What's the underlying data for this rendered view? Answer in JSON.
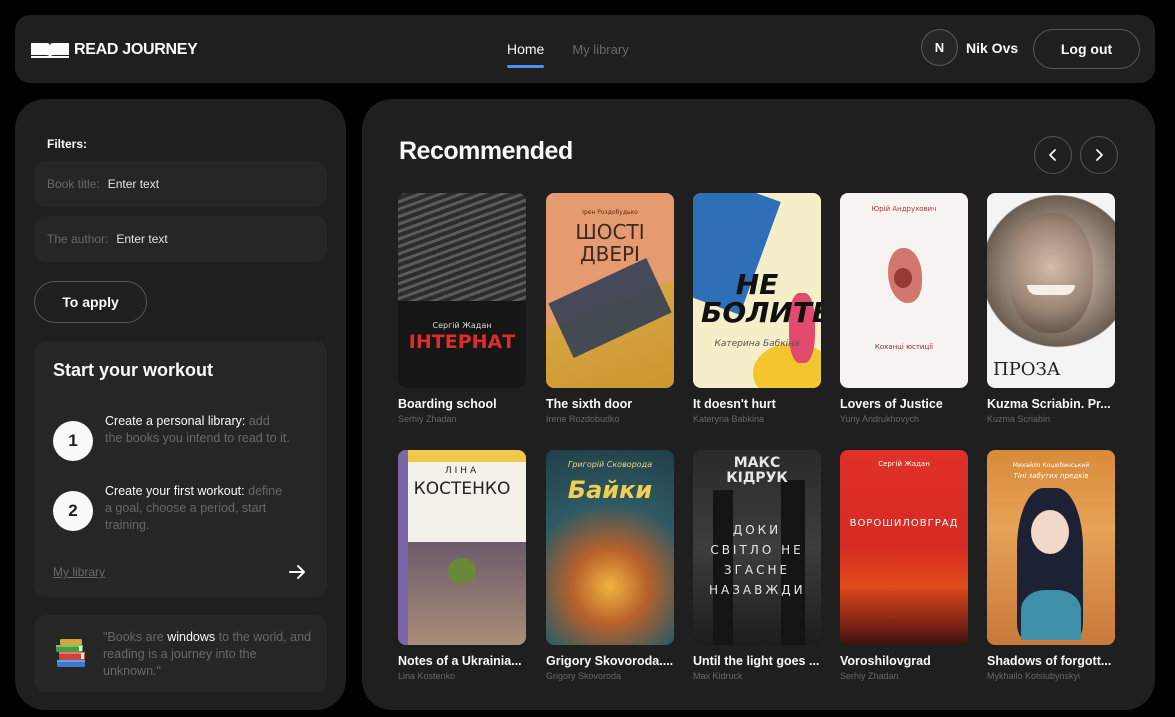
{
  "header": {
    "logo_text": "READ JOURNEY",
    "nav": {
      "home": "Home",
      "library": "My library"
    },
    "user": {
      "initial": "N",
      "name": "Nik Ovs"
    },
    "logout_label": "Log out"
  },
  "filters": {
    "heading": "Filters:",
    "title_label": "Book title:",
    "title_placeholder": "Enter text",
    "author_label": "The author:",
    "author_placeholder": "Enter text",
    "apply_label": "To apply"
  },
  "workout": {
    "title": "Start your workout",
    "steps": [
      {
        "number": "1",
        "title": "Create a personal library:",
        "desc": "add the books you intend to read to it."
      },
      {
        "number": "2",
        "title": "Create your first workout:",
        "desc": "define a goal, choose a period, start training."
      }
    ],
    "link_label": "My library"
  },
  "quote": {
    "before": "\"Books are ",
    "highlight": "windows",
    "after": " to the world, and reading is a journey into the unknown.\""
  },
  "recommended": {
    "title": "Recommended",
    "books": [
      {
        "title": "Boarding school",
        "author": "Serhiy Zhadan",
        "cover_text": "ІНТЕРНАТ",
        "cover_sub": "Сергій Жадан"
      },
      {
        "title": "The sixth door",
        "author": "Irene Rozdobudko",
        "cover_text": "ШОСТІ ДВЕРІ",
        "cover_sub": "Ірен Роздобудько"
      },
      {
        "title": "It doesn't hurt",
        "author": "Kateryna Babkina",
        "cover_text": "НЕ БОЛИТЬ",
        "cover_sub": "Катерина Бабкіна"
      },
      {
        "title": "Lovers of Justice",
        "author": "Yuriy Andrukhovych",
        "cover_text": "Коханці юстиції",
        "cover_sub": "Юрій Андрухович"
      },
      {
        "title": "Kuzma Scriabin. Pr...",
        "author": "Kuzma Scriabin",
        "cover_text": "ПРОЗА",
        "cover_sub": ""
      },
      {
        "title": "Notes of a Ukrainia...",
        "author": "Lina Kostenko",
        "cover_text": "КОСТЕНКО",
        "cover_sub": "ЛІНА"
      },
      {
        "title": "Grigory Skovoroda....",
        "author": "Grigory Skovoroda",
        "cover_text": "Байки",
        "cover_sub": "Григорій Сковорода"
      },
      {
        "title": "Until the light goes ...",
        "author": "Max Kidruck",
        "cover_text": "ДОКИ СВІТЛО НЕ ЗГАСНЕ НАЗАВЖДИ",
        "cover_sub": "МАКС КІДРУК"
      },
      {
        "title": "Voroshilovgrad",
        "author": "Serhiy Zhadan",
        "cover_text": "ВОРОШИЛОВГРАД",
        "cover_sub": "Сергій Жадан"
      },
      {
        "title": "Shadows of forgott...",
        "author": "Mykhailo Kotsiubynskyi",
        "cover_text": "Тіні забутих предків",
        "cover_sub": "Михайло Коцюбинський"
      }
    ]
  },
  "colors": {
    "bg": "#000000",
    "panel": "#1f1f1f",
    "field": "#262626",
    "accent": "#4f92f7",
    "muted": "#686868",
    "text": "#f9f9f9"
  },
  "icons": {
    "logo": "book-logo-icon",
    "prev": "chevron-left-icon",
    "next": "chevron-right-icon",
    "arrow": "arrow-right-icon",
    "books": "books-stack-icon"
  }
}
